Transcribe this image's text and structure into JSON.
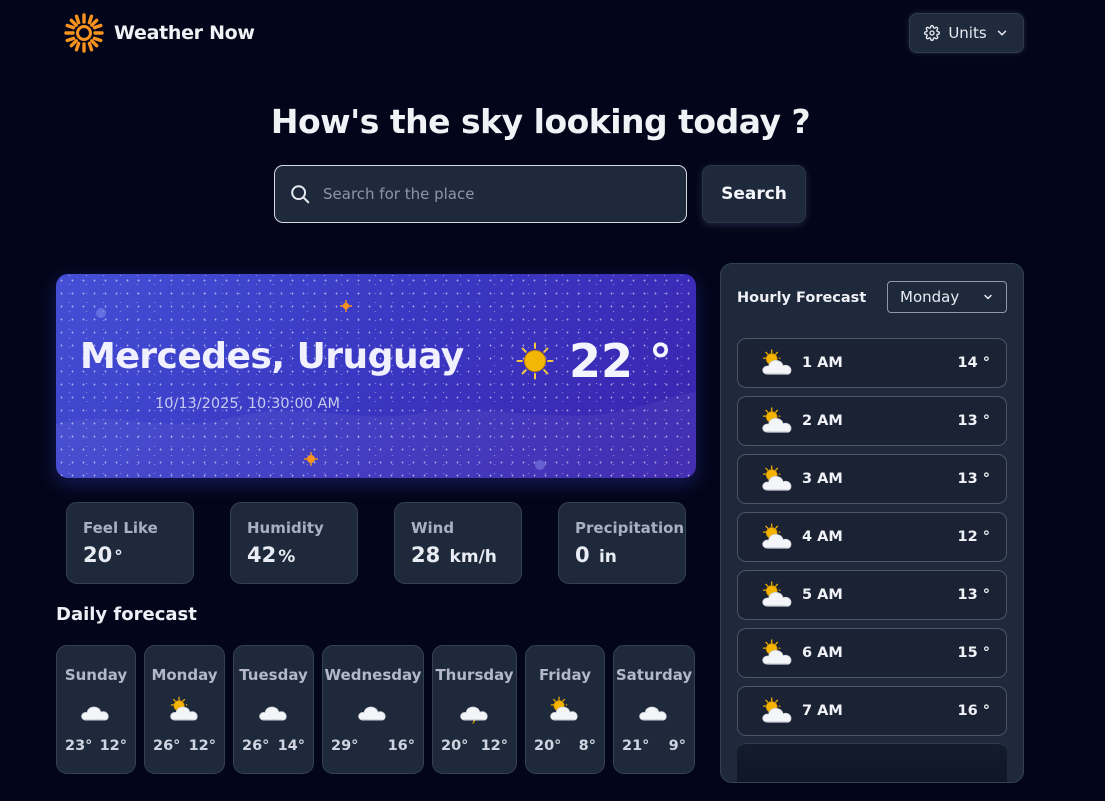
{
  "header": {
    "logo_text": "Weather Now",
    "units_label": "Units"
  },
  "headline": "How's the sky looking today ?",
  "search": {
    "placeholder": "Search for the place",
    "value": "",
    "button_label": "Search"
  },
  "current": {
    "location": "Mercedes, Uruguay",
    "datetime": "10/13/2025, 10:30:00 AM",
    "temperature": "22 °",
    "icon": "sunny-icon"
  },
  "stats": [
    {
      "label": "Feel Like",
      "value": "20",
      "unit": "°"
    },
    {
      "label": "Humidity",
      "value": "42",
      "unit": "%"
    },
    {
      "label": "Wind",
      "value": "28",
      "unit": "km/h"
    },
    {
      "label": "Precipitation",
      "value": "0",
      "unit": "in"
    }
  ],
  "daily": {
    "title": "Daily forecast",
    "days": [
      {
        "name": "Sunday",
        "icon": "cloud-icon",
        "hi": "23°",
        "lo": "12°"
      },
      {
        "name": "Monday",
        "icon": "partly-cloudy-icon",
        "hi": "26°",
        "lo": "12°"
      },
      {
        "name": "Tuesday",
        "icon": "cloud-icon",
        "hi": "26°",
        "lo": "14°"
      },
      {
        "name": "Wednesday",
        "icon": "cloud-icon",
        "hi": "29°",
        "lo": "16°"
      },
      {
        "name": "Thursday",
        "icon": "thunderstorm-icon",
        "hi": "20°",
        "lo": "12°"
      },
      {
        "name": "Friday",
        "icon": "partly-cloudy-icon",
        "hi": "20°",
        "lo": "8°"
      },
      {
        "name": "Saturday",
        "icon": "cloud-icon",
        "hi": "21°",
        "lo": "9°"
      }
    ]
  },
  "hourly": {
    "title": "Hourly Forecast",
    "selected_day": "Monday",
    "hours": [
      {
        "time": "1 AM",
        "temp": "14 °",
        "icon": "partly-cloudy-icon"
      },
      {
        "time": "2 AM",
        "temp": "13 °",
        "icon": "partly-cloudy-icon"
      },
      {
        "time": "3 AM",
        "temp": "13 °",
        "icon": "partly-cloudy-icon"
      },
      {
        "time": "4 AM",
        "temp": "12 °",
        "icon": "partly-cloudy-icon"
      },
      {
        "time": "5 AM",
        "temp": "13 °",
        "icon": "partly-cloudy-icon"
      },
      {
        "time": "6 AM",
        "temp": "15 °",
        "icon": "partly-cloudy-icon"
      },
      {
        "time": "7 AM",
        "temp": "16 °",
        "icon": "partly-cloudy-icon"
      }
    ]
  },
  "colors": {
    "background": "#03061a",
    "card": "#1e293b",
    "hero_start": "#4450d6",
    "hero_end": "#3a22ad",
    "logo_orange": "#f7931e"
  }
}
